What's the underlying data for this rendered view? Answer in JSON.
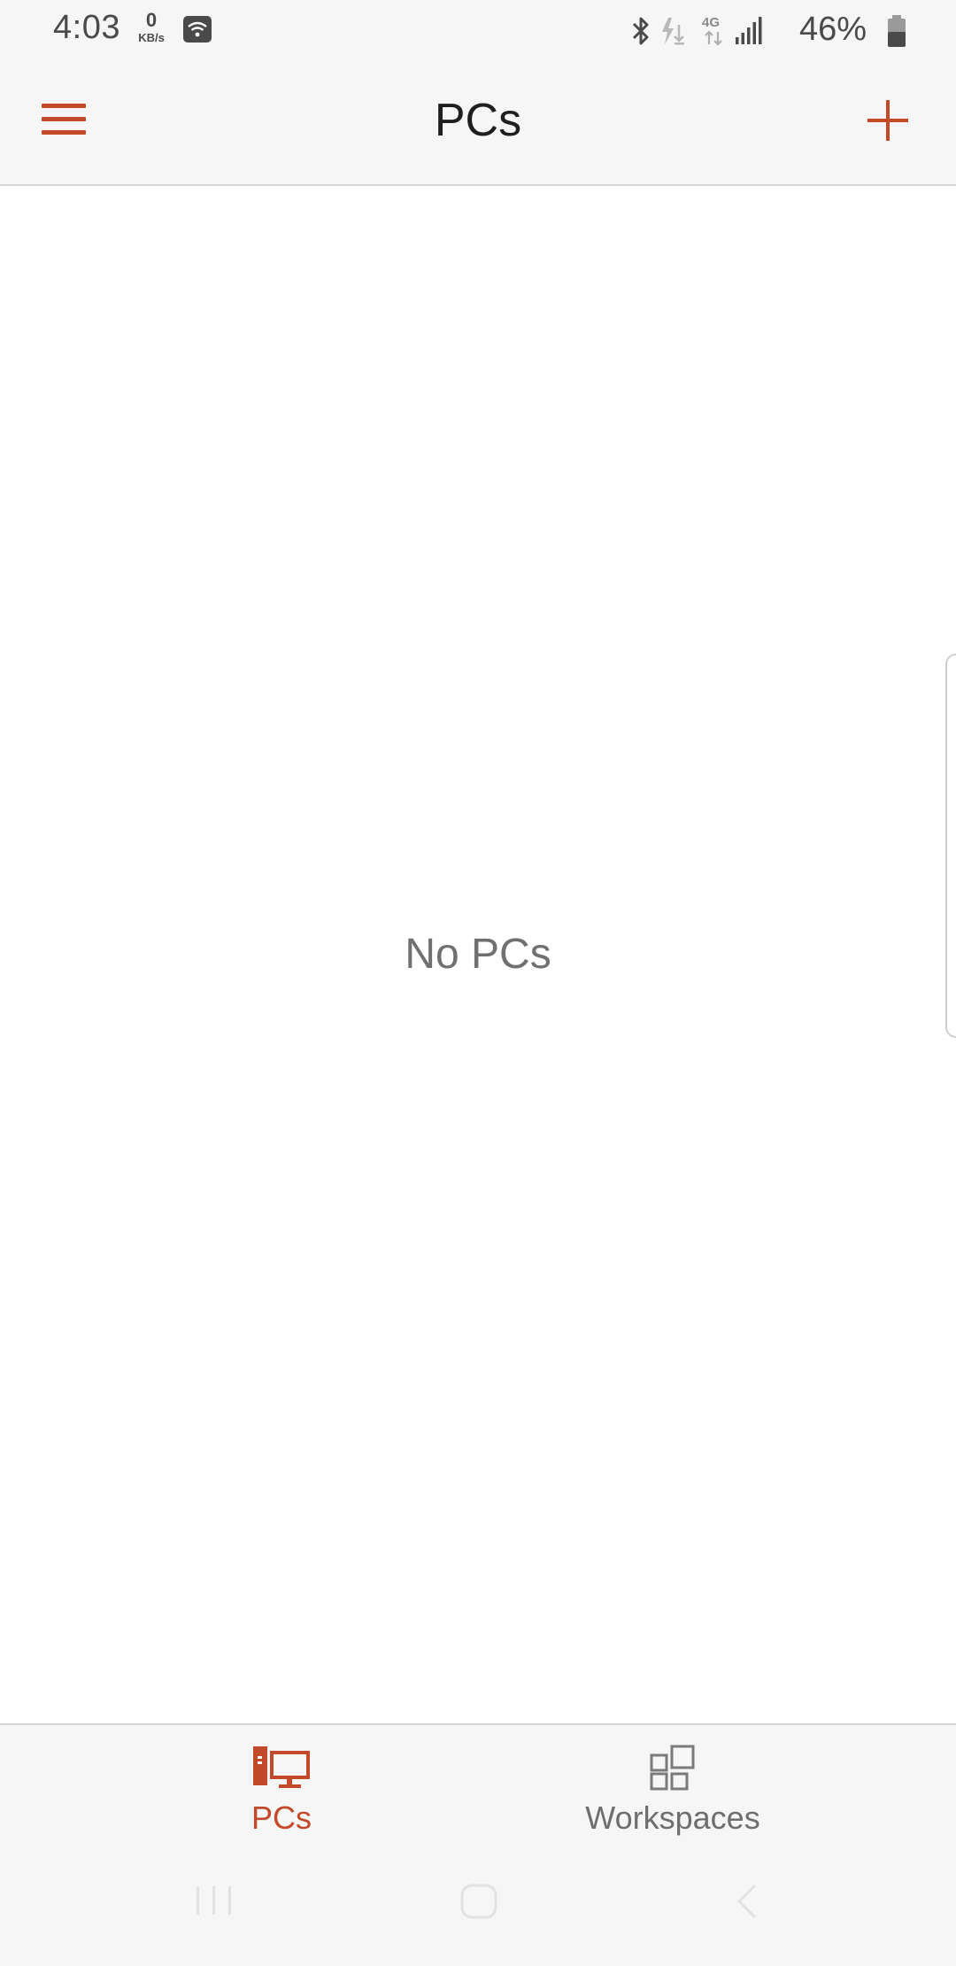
{
  "status_bar": {
    "time": "4:03",
    "net_speed_value": "0",
    "net_speed_unit": "KB/s",
    "battery_percent": "46%",
    "icons": [
      "wifi-icon",
      "bluetooth-icon",
      "data-saver-icon",
      "4g-icon",
      "signal-icon",
      "battery-icon"
    ]
  },
  "app_bar": {
    "title": "PCs",
    "menu_icon": "hamburger-menu-icon",
    "add_icon": "plus-icon"
  },
  "content": {
    "empty_message": "No PCs"
  },
  "bottom_nav": {
    "tabs": [
      {
        "label": "PCs",
        "icon": "pc-icon",
        "selected": true
      },
      {
        "label": "Workspaces",
        "icon": "workspaces-icon",
        "selected": false
      }
    ]
  },
  "system_nav": {
    "buttons": [
      "recents-icon",
      "home-icon",
      "back-icon"
    ]
  },
  "colors": {
    "accent": "#c24a2a",
    "bar_background": "#f6f6f6",
    "content_background": "#ffffff",
    "title_text": "#1f1f1f",
    "muted_text": "#707070"
  }
}
